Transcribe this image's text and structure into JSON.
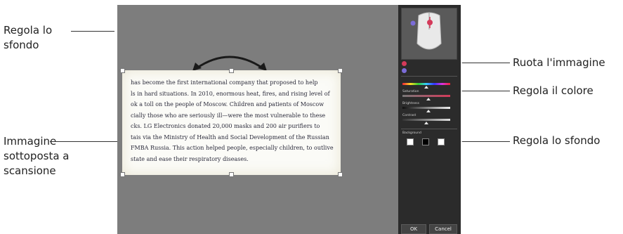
{
  "callouts": {
    "left_background": "Regola lo sfondo",
    "left_scanned": "Immagine sottoposta a scansione",
    "right_rotate": "Ruota l'immagine",
    "right_color": "Regola il colore",
    "right_background": "Regola lo sfondo"
  },
  "document": {
    "lines": [
      "has become the first international company that proposed to help",
      "ls in hard situations. In 2010, enormous heat, fires, and rising level of",
      "ok a toll on the people of Moscow. Children and patients of Moscow",
      "cially those who are seriously ill—were the most vulnerable to these",
      "cks. LG Electronics donated 20,000 masks and 200 air purifiers to",
      "tais via the Ministry of Health and Social Development of the Russian",
      "FMBA Russia. This action helped people, especially children, to outlive",
      "state and ease their respiratory diseases."
    ]
  },
  "panel": {
    "mode_a_label": "",
    "mode_b_label": "",
    "color_label": "",
    "saturation_label": "Saturation",
    "brightness_label": "Brightness",
    "contrast_label": "Contrast",
    "background_label": "Background",
    "ok_label": "OK",
    "cancel_label": "Cancel",
    "levels": {
      "color": 0.5,
      "saturation": 0.55,
      "brightness": 0.55,
      "contrast": 0.5
    },
    "background_swatches": [
      "#ffffff",
      "#000000",
      "#ffffff"
    ]
  },
  "colors": {
    "canvas": "#7d7d7d",
    "panel": "#2b2b2b",
    "mode_a": "#7b6cd8",
    "mode_b": "#7b6cd8",
    "accent_red": "#d43a5a"
  }
}
